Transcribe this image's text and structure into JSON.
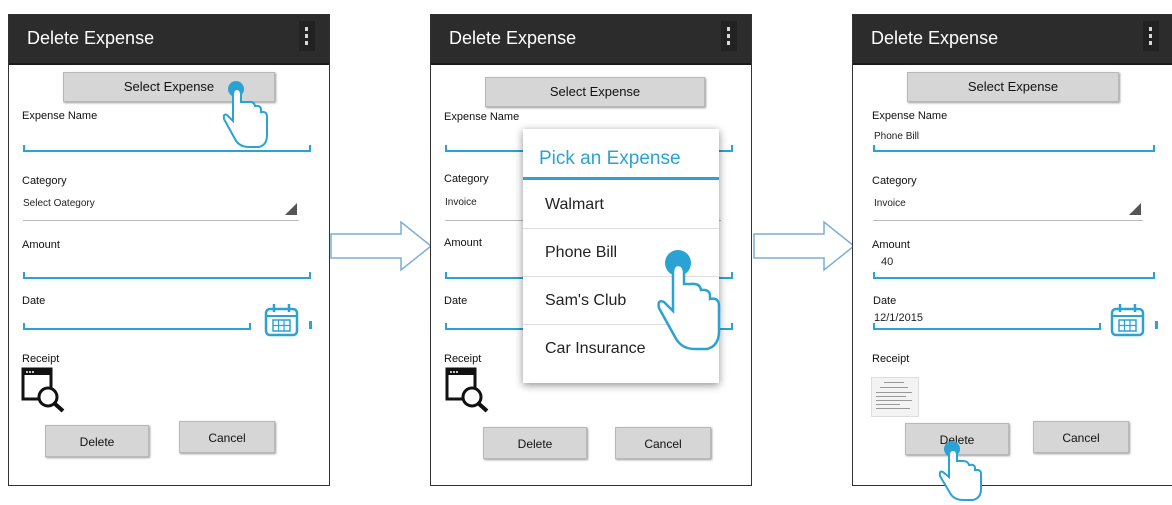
{
  "screens": [
    {
      "title": "Delete Expense",
      "select_button": "Select Expense",
      "expense_name_label": "Expense Name",
      "expense_name_value": "",
      "category_label": "Category",
      "category_value": "Select Oategory",
      "amount_label": "Amount",
      "amount_value": "",
      "date_label": "Date",
      "date_value": "",
      "receipt_label": "Receipt",
      "delete_button": "Delete",
      "cancel_button": "Cancel"
    },
    {
      "title": "Delete Expense",
      "select_button": "Select Expense",
      "expense_name_label": "Expense Name",
      "category_label": "Category",
      "category_value": "Invoice",
      "amount_label": "Amount",
      "date_label": "Date",
      "receipt_label": "Receipt",
      "delete_button": "Delete",
      "cancel_button": "Cancel",
      "popup": {
        "title": "Pick an Expense",
        "items": [
          "Walmart",
          "Phone Bill",
          "Sam's Club",
          "Car Insurance"
        ]
      }
    },
    {
      "title": "Delete Expense",
      "select_button": "Select Expense",
      "expense_name_label": "Expense Name",
      "expense_name_value": "Phone Bill",
      "category_label": "Category",
      "category_value": "Invoice",
      "amount_label": "Amount",
      "amount_value": "40",
      "date_label": "Date",
      "date_value": "12/1/2015",
      "receipt_label": "Receipt",
      "delete_button": "Delete",
      "cancel_button": "Cancel"
    }
  ],
  "icons": {
    "menu": "overflow-menu-icon",
    "calendar": "calendar-icon",
    "receipt": "receipt-search-icon",
    "hand": "tap-hand-icon",
    "arrow": "flow-arrow"
  },
  "colors": {
    "accent": "#2aa3d4",
    "titlebar": "#2c2c2c",
    "button": "#d6d6d6"
  }
}
